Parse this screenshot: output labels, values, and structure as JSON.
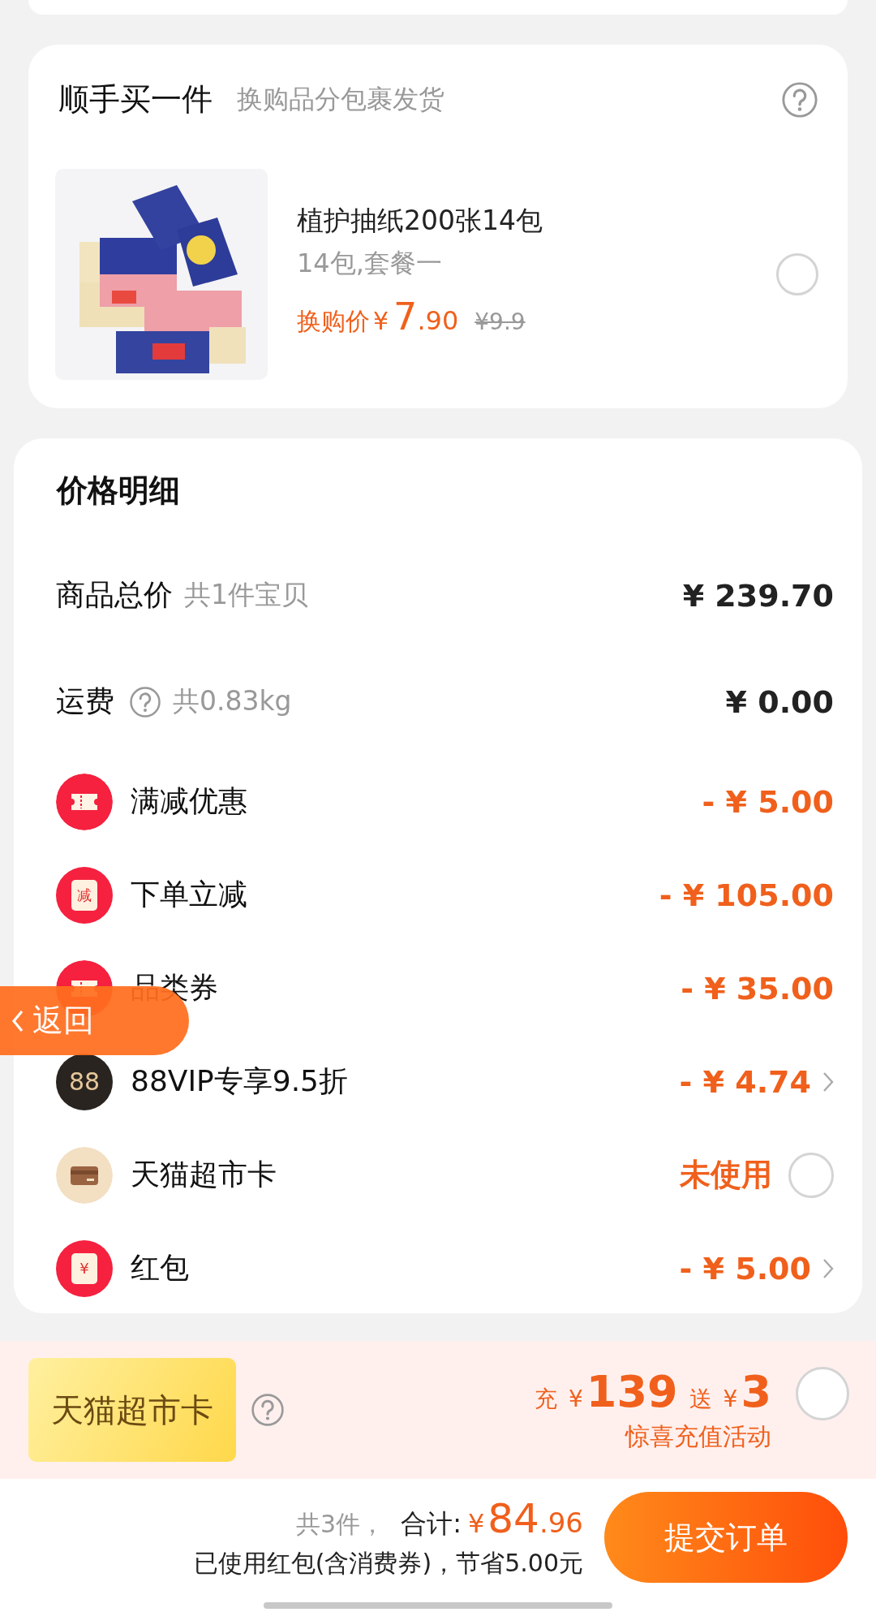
{
  "addon": {
    "title": "顺手买一件",
    "subtitle": "换购品分包裹发货",
    "product": {
      "kind": "picture",
      "name": "植护抽纸200张14包",
      "spec": "14包,套餐一",
      "price_label": "换购价",
      "price": "¥7.90",
      "original_price": "¥9.9",
      "selected": false
    }
  },
  "price_detail": {
    "title": "价格明细",
    "rows": [
      {
        "kind": "plain",
        "label": "商品总价",
        "note": "共1件宝贝",
        "value": "¥ 239.70",
        "help": false
      },
      {
        "kind": "plain",
        "label": "运费",
        "note": "共0.83kg",
        "value": "¥ 0.00",
        "help": true
      },
      {
        "kind": "ticket",
        "label": "满减优惠",
        "value": "- ¥ 5.00",
        "link": false
      },
      {
        "kind": "seal",
        "icon_text": "减",
        "label": "下单立减",
        "value": "- ¥ 105.00",
        "link": false
      },
      {
        "kind": "ticket",
        "label": "品类券",
        "value": "- ¥ 35.00",
        "link": false
      },
      {
        "kind": "vip",
        "icon_text": "88",
        "label": "88VIP专享9.5折",
        "value": "- ¥ 4.74",
        "link": true
      },
      {
        "kind": "card",
        "label": "天猫超市卡",
        "value": "未使用",
        "link": false,
        "selected": false
      },
      {
        "kind": "seal",
        "icon_text": "¥",
        "label": "红包",
        "value": "- ¥ 5.00",
        "link": true
      }
    ]
  },
  "back_button": {
    "label": "返回"
  },
  "recharge": {
    "card_label": "天猫超市卡",
    "offer": [
      {
        "kind": "label",
        "text": "充"
      },
      {
        "kind": "amount",
        "text": "¥139"
      },
      {
        "kind": "label",
        "text": "送"
      },
      {
        "kind": "amount",
        "text": "¥3"
      }
    ],
    "note": "惊喜充值活动",
    "selected": false
  },
  "footer": {
    "count": "共3件，",
    "total_label": "合计:",
    "total": "¥84.96",
    "savings": "已使用红包(含消费券)，节省5.00元",
    "submit": "提交订单"
  }
}
